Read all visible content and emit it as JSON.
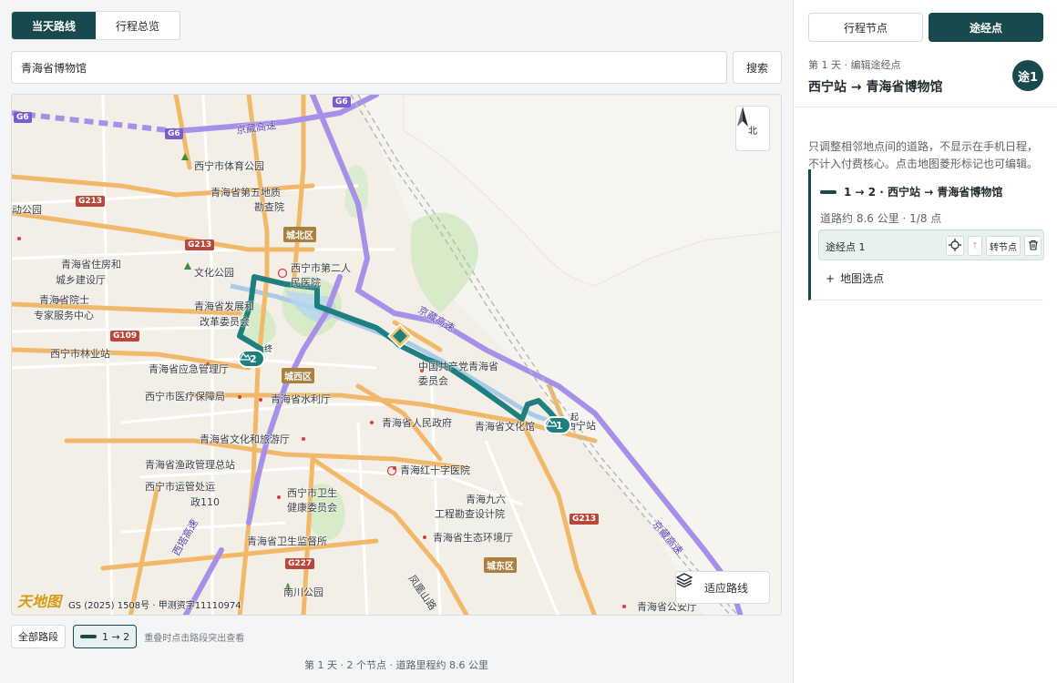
{
  "tabs": {
    "today": "当天路线",
    "overview": "行程总览"
  },
  "search": {
    "value": "青海省博物馆",
    "button": "搜索"
  },
  "map": {
    "compass": "北",
    "fit_button": "适应路线",
    "logo": "天地图",
    "copyright": "GS (2025) 1508号 · 甲测资字11110974",
    "districts": [
      "城北区",
      "城西区",
      "城东区"
    ],
    "shields": [
      "G6",
      "G6",
      "G6",
      "G213",
      "G213",
      "G109",
      "G213",
      "G227"
    ],
    "highways": [
      "京藏高速",
      "京藏高速",
      "京藏高速",
      "西塔高速",
      "凤凰山路"
    ],
    "labels": [
      "西宁市体育公园",
      "青海省第五地质",
      "勘查院",
      "动公园",
      "青海省住房和",
      "城乡建设厅",
      "文化公园",
      "西宁市第二人",
      "民医院",
      "青海省院士",
      "专家服务中心",
      "青海省发展和",
      "改革委员会",
      "西宁市林业站",
      "青海省应急管理厅",
      "中国共产党青海省",
      "委员会",
      "西宁市医疗保障局",
      "青海省水利厅",
      "青海省人民政府",
      "青海省文化馆",
      "西宁站",
      "青海省文化和旅游厅",
      "青海省渔政管理总站",
      "青海红十字医院",
      "西宁市运管处运",
      "政110",
      "西宁市卫生",
      "健康委员会",
      "青海九六",
      "工程勘查设计院",
      "青海省卫生监督所",
      "青海省生态环境厅",
      "南川公园",
      "青海省公安厅"
    ],
    "markers": {
      "start": {
        "label": "1",
        "tag": "起"
      },
      "end": {
        "label": "2",
        "tag": "终"
      }
    }
  },
  "segments": {
    "all": "全部路段",
    "active": "1 → 2",
    "hint": "重叠时点击路段突出查看"
  },
  "footer": "第 1 天 · 2 个节点 · 道路里程约 8.6 公里",
  "panel": {
    "tabs": {
      "nodes": "行程节点",
      "waypoints": "途经点"
    },
    "subtitle": "第 1 天 · 编辑途经点",
    "title": "西宁站 → 青海省博物馆",
    "badge": "途1",
    "description": "只调整相邻地点间的道路，不显示在手机日程，不计入付费核心。点击地图菱形标记也可编辑。",
    "segment": {
      "title": "1 → 2 · 西宁站 → 青海省博物馆",
      "meta": "道路约 8.6 公里 · 1/8 点",
      "waypoint_name": "途经点 1",
      "up_icon": "↑",
      "convert_button": "转节点",
      "add_label": "地图选点",
      "add_icon": "+"
    }
  },
  "colors": {
    "accent": "#17494d",
    "route": "#1e7f80",
    "highway": "#a88fe8",
    "arterial": "#f2b86a"
  }
}
